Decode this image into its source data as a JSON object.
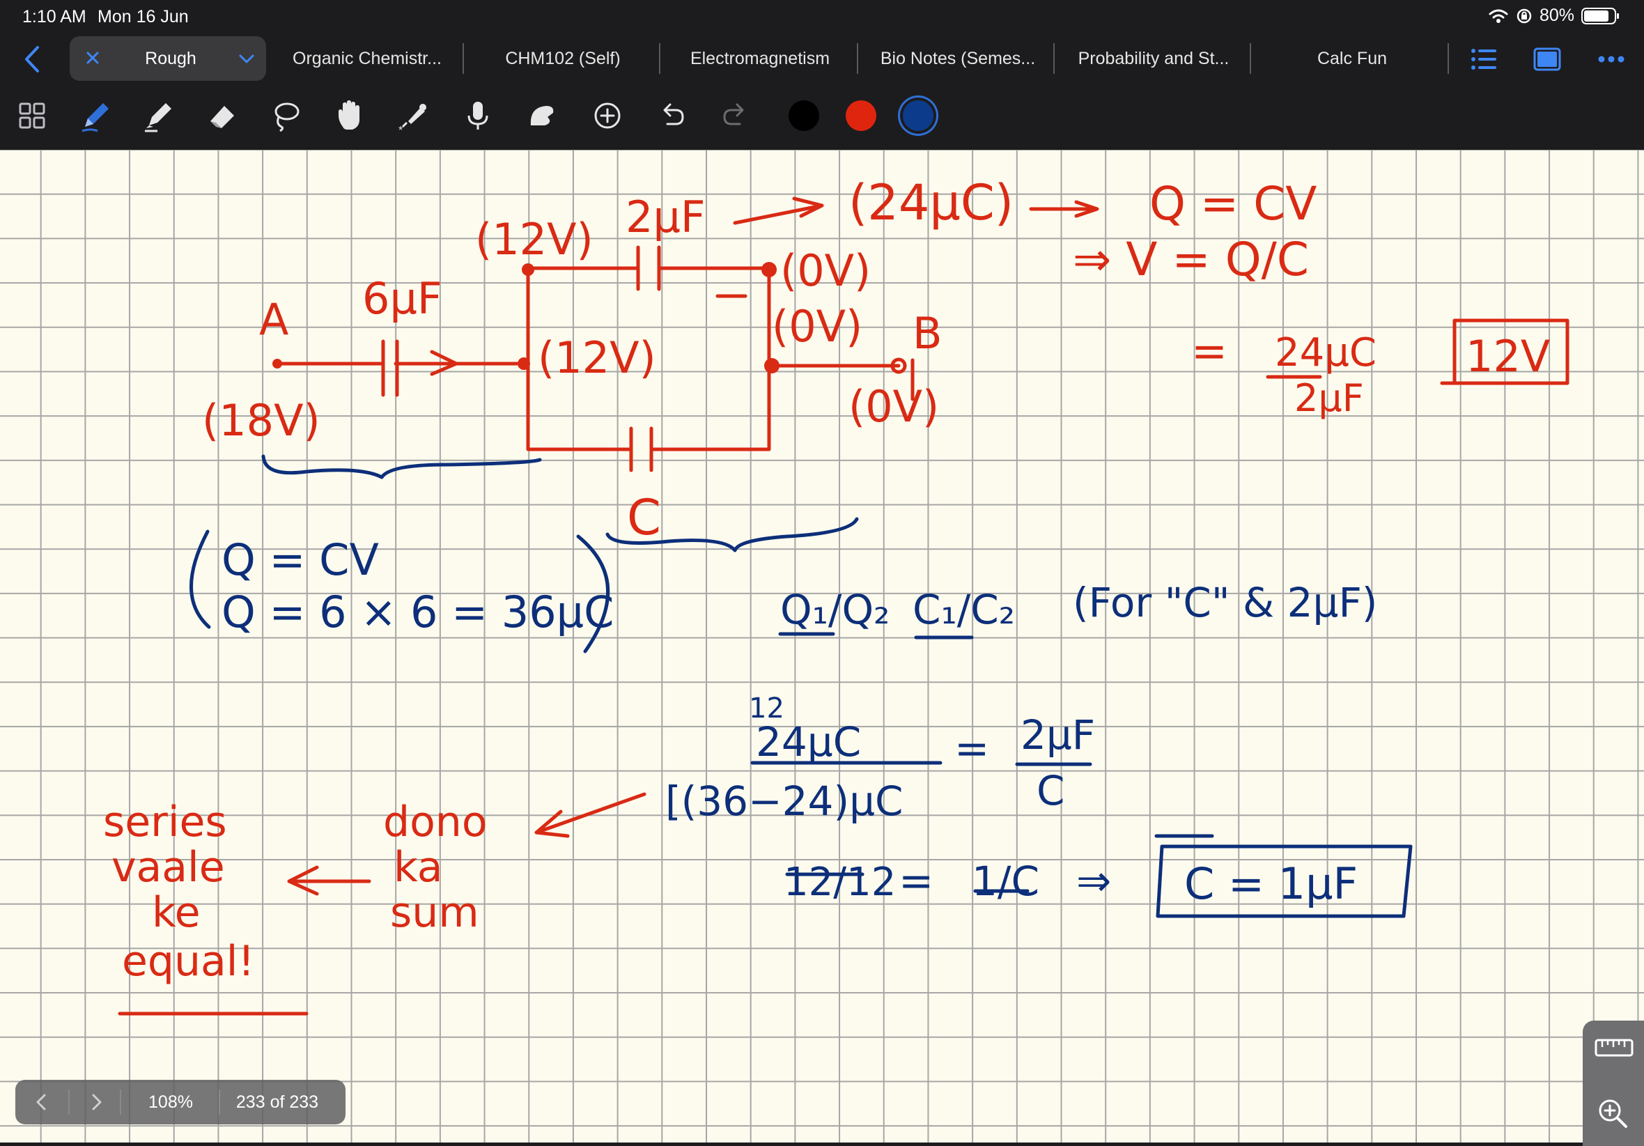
{
  "status_bar": {
    "time": "1:10 AM",
    "date": "Mon 16 Jun",
    "battery": "80%"
  },
  "tabs": {
    "active": "Rough",
    "items": [
      "Organic Chemistr...",
      "CHM102 (Self)",
      "Electromagnetism",
      "Bio Notes (Semes...",
      "Probability and St...",
      "Calc Fun"
    ]
  },
  "toolbar": {
    "tools": [
      "grid-view-icon",
      "pen-icon",
      "highlighter-icon",
      "eraser-icon",
      "lasso-icon",
      "hand-icon",
      "laser-pointer-icon",
      "microphone-icon",
      "shape-icon",
      "add-icon",
      "undo-icon",
      "redo-icon"
    ],
    "colors": [
      "#000000",
      "#e0250f",
      "#0d3b8c"
    ],
    "selected_color": "#0d3b8c"
  },
  "note": {
    "red": {
      "node_a": "A",
      "node_b": "B",
      "v_a": "(18V)",
      "v_b": "(0V)",
      "cap_6": "6μF",
      "v_12_top": "(12V)",
      "v_12_mid": "(12V)",
      "v_0_top": "(0V)",
      "v_0_mid": "(0V)",
      "cap_2": "2μF",
      "charge_24": "(24μC)",
      "cap_c": "C",
      "eq1": "Q = CV",
      "eq2": "⇒  V = Q/C",
      "eq3_num": "24μC",
      "eq3_den": "2μF",
      "eq3_eq": "=",
      "result_12v": "12V",
      "note1": "series",
      "note2": "vaale",
      "note3": "ke",
      "note4": "equal!",
      "note5": "dono",
      "note6": "ka",
      "note7": "sum"
    },
    "blue": {
      "q_line1": "Q = CV",
      "q_line2": "Q = 6 × 6 = 36μC",
      "ratio_q": "Q₁/Q₂",
      "ratio_c": "C₁/C₂",
      "for_note": "(For \"C\" & 2μF)",
      "frac_top": "24μC",
      "frac_top_strike": "12",
      "frac_bottom": "[(36−24)μC",
      "frac_right_top": "2μF",
      "frac_right_bottom": "C",
      "twelve_over_twelve": "12/12",
      "one_over_c": "1/C",
      "implies": "⇒",
      "result": "C = 1μF"
    }
  },
  "pager": {
    "zoom": "108%",
    "page": "233 of 233"
  }
}
